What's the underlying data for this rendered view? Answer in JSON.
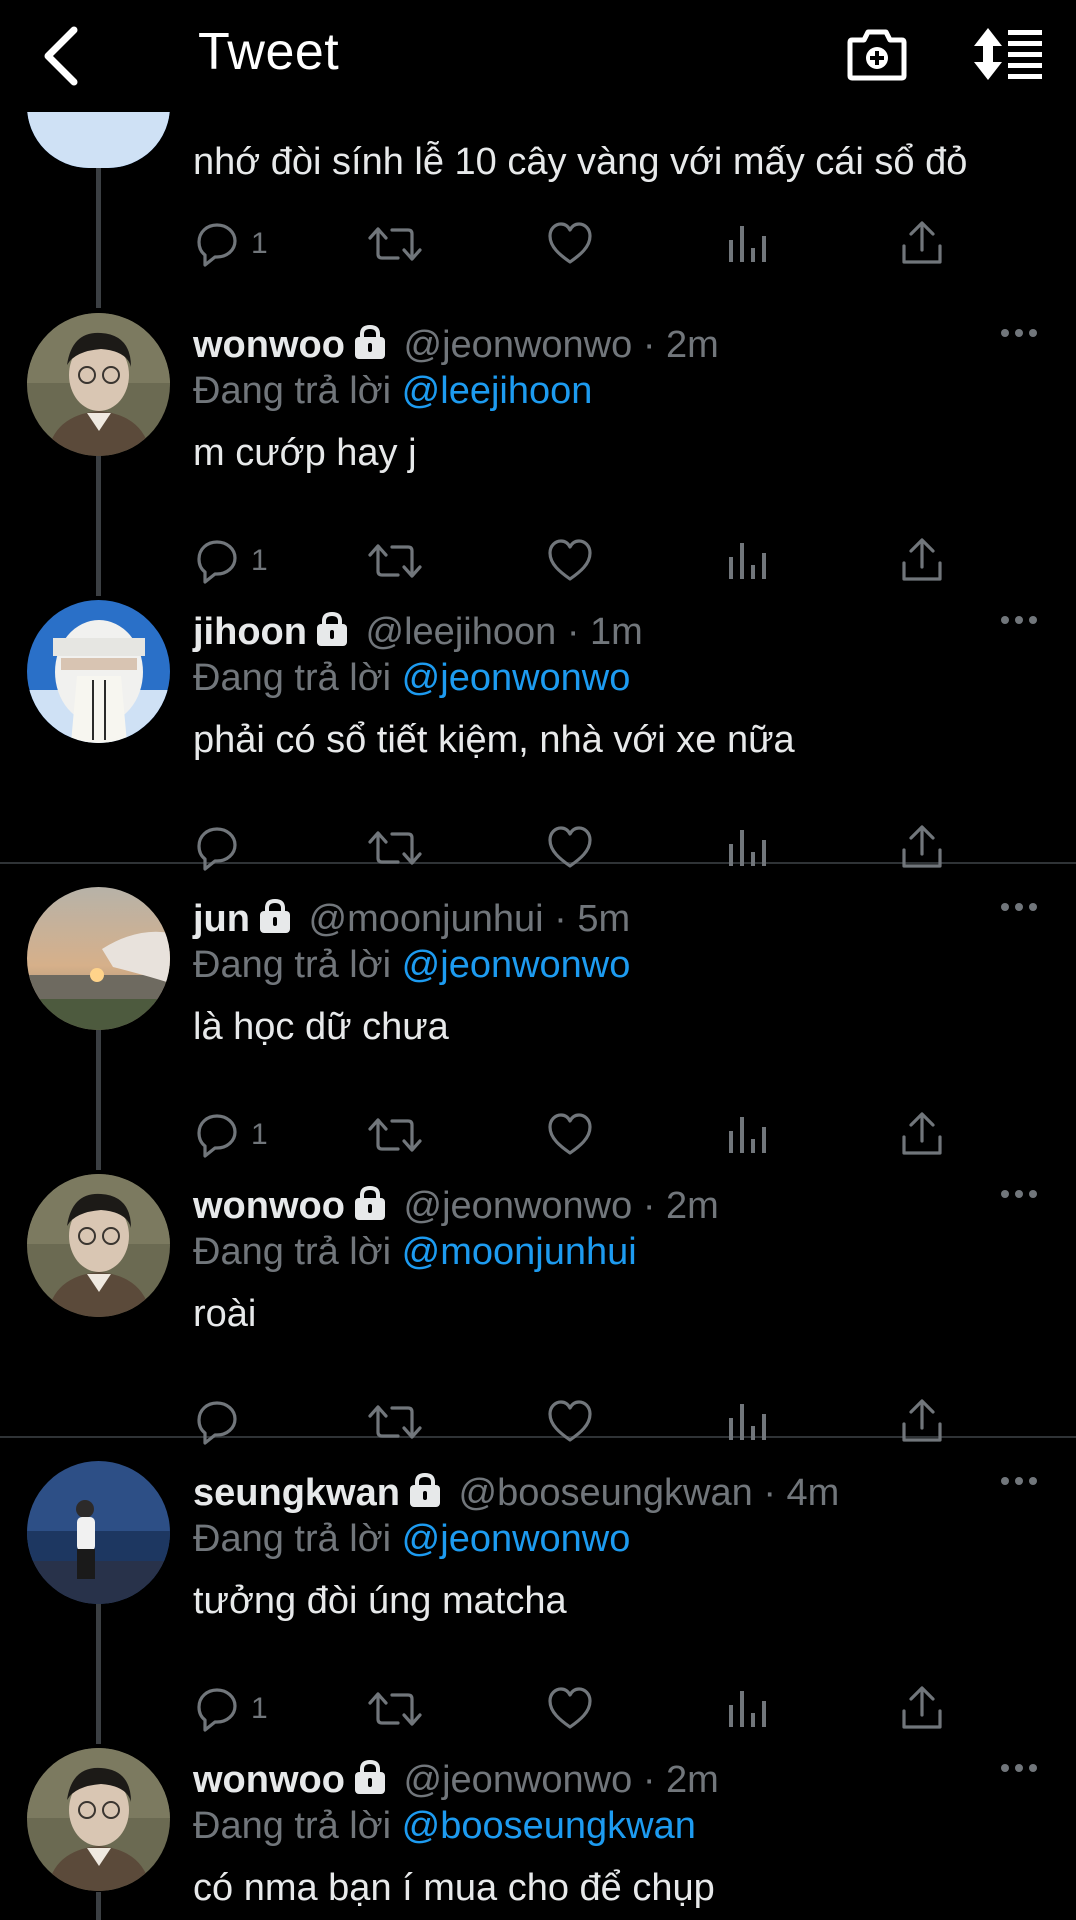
{
  "header": {
    "title": "Tweet"
  },
  "top_post": {
    "text": "nhớ đòi sính lễ 10 cây vàng với mấy cái sổ đỏ",
    "reply_count": "1"
  },
  "posts": [
    {
      "name": "wonwoo",
      "handle": "@jeonwonwo",
      "dot": "·",
      "time": "2m",
      "reply_prefix": "Đang trả lời",
      "reply_to": "@leejihoon",
      "text": "m cướp hay j",
      "reply_count": "1"
    },
    {
      "name": "jihoon",
      "handle": "@leejihoon",
      "dot": "·",
      "time": "1m",
      "reply_prefix": "Đang trả lời",
      "reply_to": "@jeonwonwo",
      "text": "phải có sổ tiết kiệm, nhà với xe nữa",
      "reply_count": ""
    },
    {
      "name": "jun",
      "handle": "@moonjunhui",
      "dot": "·",
      "time": "5m",
      "reply_prefix": "Đang trả lời",
      "reply_to": "@jeonwonwo",
      "text": "là học dữ chưa",
      "reply_count": "1"
    },
    {
      "name": "wonwoo",
      "handle": "@jeonwonwo",
      "dot": "·",
      "time": "2m",
      "reply_prefix": "Đang trả lời",
      "reply_to": "@moonjunhui",
      "text": "roài",
      "reply_count": ""
    },
    {
      "name": "seungkwan",
      "handle": "@booseungkwan",
      "dot": "·",
      "time": "4m",
      "reply_prefix": "Đang trả lời",
      "reply_to": "@jeonwonwo",
      "text": "tưởng đòi úng matcha",
      "reply_count": "1"
    },
    {
      "name": "wonwoo",
      "handle": "@jeonwonwo",
      "dot": "·",
      "time": "2m",
      "reply_prefix": "Đang trả lời",
      "reply_to": "@booseungkwan",
      "text": "có nma bạn í mua cho để chụp",
      "reply_count": ""
    }
  ],
  "colors": {
    "background": "#000000",
    "text": "#e7e9ea",
    "muted": "#71767b",
    "link": "#1d9bf0",
    "thread_line": "#3b3f43",
    "divider": "#2f3336"
  },
  "icons": {
    "back": "chevron-left-icon",
    "camera": "camera-plus-icon",
    "sort": "sort-icon",
    "reply": "reply-icon",
    "retweet": "retweet-icon",
    "like": "heart-icon",
    "stats": "analytics-icon",
    "share": "share-icon",
    "protected": "lock-icon",
    "more": "more-icon"
  }
}
